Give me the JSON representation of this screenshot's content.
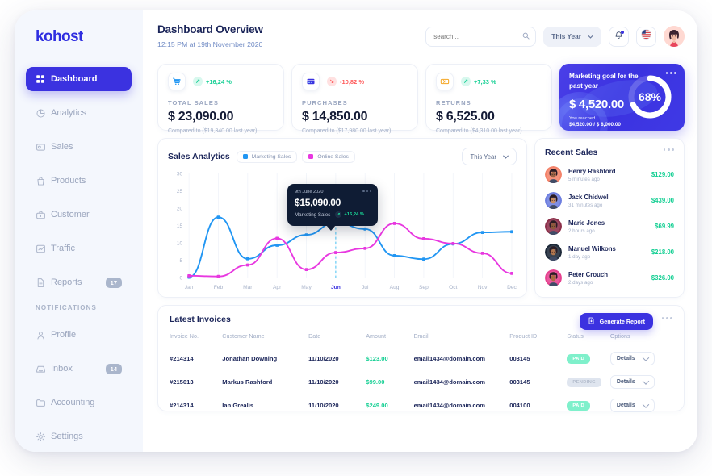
{
  "brand": {
    "name": "kohost"
  },
  "sidebar": {
    "items": [
      {
        "label": "Dashboard",
        "icon": "grid-icon",
        "active": true,
        "badge": ""
      },
      {
        "label": "Analytics",
        "icon": "pie-icon",
        "active": false,
        "badge": ""
      },
      {
        "label": "Sales",
        "icon": "card-icon",
        "active": false,
        "badge": ""
      },
      {
        "label": "Products",
        "icon": "bag-icon",
        "active": false,
        "badge": ""
      },
      {
        "label": "Customer",
        "icon": "briefcase-icon",
        "active": false,
        "badge": ""
      },
      {
        "label": "Traffic",
        "icon": "chart-icon",
        "active": false,
        "badge": ""
      },
      {
        "label": "Reports",
        "icon": "document-icon",
        "active": false,
        "badge": "17"
      }
    ],
    "section_label": "NOTIFICATIONS",
    "notification_items": [
      {
        "label": "Profile",
        "icon": "user-icon",
        "badge": ""
      },
      {
        "label": "Inbox",
        "icon": "inbox-icon",
        "badge": "14"
      },
      {
        "label": "Accounting",
        "icon": "folder-icon",
        "badge": ""
      },
      {
        "label": "Settings",
        "icon": "gear-icon",
        "badge": ""
      }
    ]
  },
  "header": {
    "title": "Dashboard Overview",
    "subtitle": "12:15 PM at 19th November 2020",
    "search_placeholder": "search...",
    "search_value": "",
    "year_filter": "This Year",
    "notification_icon": "bell-icon",
    "flag_icon": "usa-flag-icon",
    "avatar_icon": "user-avatar"
  },
  "stats": [
    {
      "icon": "shopping-cart-icon",
      "pct": "+16,24 %",
      "direction": "up",
      "label": "TOTAL SALES",
      "value": "$ 23,090.00",
      "compare": "Compared to ($19,340.00 last year)"
    },
    {
      "icon": "credit-card-icon",
      "pct": "-10,82 %",
      "direction": "down",
      "label": "PURCHASES",
      "value": "$ 14,850.00",
      "compare": "Compared to ($17,980.00 last year)"
    },
    {
      "icon": "discount-tag-icon",
      "pct": "+7,33 %",
      "direction": "up",
      "label": "RETURNS",
      "value": "$ 6,525.00",
      "compare": "Compared to ($4,310.00 last year)"
    }
  ],
  "goal": {
    "title": "Marketing goal for the past year",
    "value": "$ 4,520.00",
    "reached_label": "You reached",
    "reached_value": "$4,520.00 / $ 8,000.00",
    "percent_label": "68%",
    "percent": 68
  },
  "sales_analytics": {
    "title": "Sales Analytics",
    "legend": [
      {
        "label": "Marketing Sales",
        "color": "#2196f3"
      },
      {
        "label": "Online Sales",
        "color": "#e838e0"
      }
    ],
    "year_filter": "This Year",
    "tooltip": {
      "date": "9th June 2020",
      "value": "$15,090.00",
      "series": "Marketing Sales",
      "pct": "+16,24 %"
    }
  },
  "chart_data": {
    "type": "line",
    "title": "Sales Analytics",
    "xlabel": "",
    "ylabel": "",
    "categories": [
      "Jan",
      "Feb",
      "Mar",
      "Apr",
      "May",
      "Jun",
      "Jul",
      "Aug",
      "Sep",
      "Oct",
      "Nov",
      "Dec"
    ],
    "yticks": [
      0,
      5,
      10,
      15,
      20,
      25,
      30
    ],
    "ylim": [
      0,
      30
    ],
    "grid": "vertical",
    "legend_position": "top-left",
    "highlight": {
      "category": "Jun",
      "series": "Marketing Sales",
      "value": 15.9,
      "label": "$15,090.00"
    },
    "series": [
      {
        "name": "Marketing Sales",
        "color": "#2196f3",
        "values": [
          0.1,
          17.4,
          5.4,
          9.3,
          12.3,
          15.9,
          14.0,
          6.3,
          5.3,
          9.7,
          13.0,
          13.2
        ]
      },
      {
        "name": "Online Sales",
        "color": "#e838e0",
        "values": [
          0.5,
          0.3,
          3.6,
          11.3,
          2.3,
          7.2,
          8.4,
          15.6,
          11.2,
          9.8,
          7.0,
          1.2
        ]
      }
    ]
  },
  "recent_sales": {
    "title": "Recent Sales",
    "items": [
      {
        "name": "Henry Rashford",
        "time": "5 minutes ago",
        "amount": "$129.00",
        "avatar_color": "#f4836a"
      },
      {
        "name": "Jack Chidwell",
        "time": "31 minutes ago",
        "amount": "$439.00",
        "avatar_color": "#6e7fe0"
      },
      {
        "name": "Marie Jones",
        "time": "2 hours ago",
        "amount": "$69.99",
        "avatar_color": "#8c2f4a"
      },
      {
        "name": "Manuel Wilkons",
        "time": "1 day ago",
        "amount": "$218.00",
        "avatar_color": "#1e2a3a"
      },
      {
        "name": "Peter Crouch",
        "time": "2 days ago",
        "amount": "$326.00",
        "avatar_color": "#e6408f"
      }
    ]
  },
  "invoices": {
    "title": "Latest Invoices",
    "generate_report_label": "Generate Report",
    "columns": [
      "Invoice No.",
      "Customer Name",
      "Date",
      "Amount",
      "Email",
      "Product ID",
      "Status",
      "Options"
    ],
    "details_label": "Details",
    "rows": [
      {
        "invoice": "#214314",
        "customer": "Jonathan Downing",
        "date": "11/10/2020",
        "amount": "$123.00",
        "email": "email1434@domain.com",
        "product_id": "003145",
        "status": "PAID",
        "status_type": "paid"
      },
      {
        "invoice": "#215613",
        "customer": "Markus Rashford",
        "date": "11/10/2020",
        "amount": "$99.00",
        "email": "email1434@domain.com",
        "product_id": "003145",
        "status": "PENDING",
        "status_type": "pending"
      },
      {
        "invoice": "#214314",
        "customer": "Ian Grealis",
        "date": "11/10/2020",
        "amount": "$249.00",
        "email": "email1434@domain.com",
        "product_id": "004100",
        "status": "PAID",
        "status_type": "paid"
      }
    ]
  },
  "colors": {
    "accent": "#3b32e0",
    "positive": "#14cf93",
    "negative": "#ff5b5b",
    "marketing": "#2196f3",
    "online": "#e838e0",
    "sidebar_bg": "#f4f7fd"
  }
}
